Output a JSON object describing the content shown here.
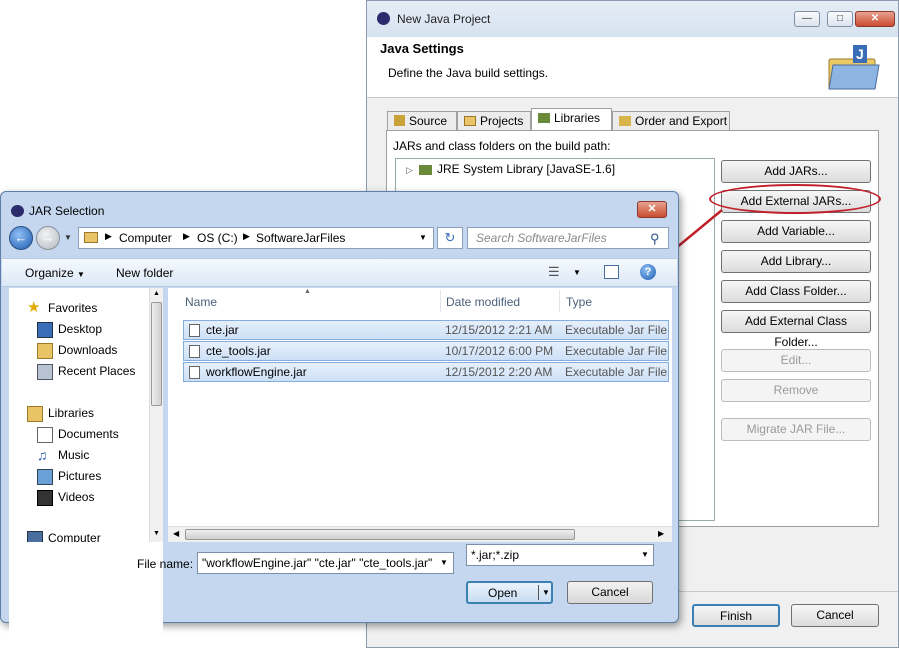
{
  "eclipse": {
    "title": "New Java Project",
    "header_title": "Java Settings",
    "header_desc": "Define the Java build settings.",
    "tabs": [
      "Source",
      "Projects",
      "Libraries",
      "Order and Export"
    ],
    "build_path_label": "JARs and class folders on the build path:",
    "tree_item": "JRE System Library [JavaSE-1.6]",
    "buttons": [
      "Add JARs...",
      "Add External JARs...",
      "Add Variable...",
      "Add Library...",
      "Add Class Folder...",
      "Add External Class Folder...",
      "Edit...",
      "Remove",
      "Migrate JAR File..."
    ],
    "finish": "Finish",
    "cancel": "Cancel"
  },
  "jar": {
    "title": "JAR Selection",
    "breadcrumb": [
      "Computer",
      "OS (C:)",
      "SoftwareJarFiles"
    ],
    "search_placeholder": "Search SoftwareJarFiles",
    "organize": "Organize",
    "new_folder": "New folder",
    "nav": [
      {
        "label": "Favorites",
        "icon": "star-icon"
      },
      {
        "label": "Desktop",
        "icon": "desktop-icon"
      },
      {
        "label": "Downloads",
        "icon": "downloads-icon"
      },
      {
        "label": "Recent Places",
        "icon": "recent-places-icon"
      },
      {
        "label": "Libraries",
        "icon": "libraries-icon"
      },
      {
        "label": "Documents",
        "icon": "documents-icon"
      },
      {
        "label": "Music",
        "icon": "music-icon"
      },
      {
        "label": "Pictures",
        "icon": "pictures-icon"
      },
      {
        "label": "Videos",
        "icon": "videos-icon"
      },
      {
        "label": "Computer",
        "icon": "computer-icon"
      }
    ],
    "columns": [
      "Name",
      "Date modified",
      "Type"
    ],
    "files": [
      {
        "name": "cte.jar",
        "date": "12/15/2012 2:21 AM",
        "type": "Executable Jar File"
      },
      {
        "name": "cte_tools.jar",
        "date": "10/17/2012 6:00 PM",
        "type": "Executable Jar File"
      },
      {
        "name": "workflowEngine.jar",
        "date": "12/15/2012 2:20 AM",
        "type": "Executable Jar File"
      }
    ],
    "file_name_label": "File name:",
    "file_name_value": "\"workflowEngine.jar\" \"cte.jar\" \"cte_tools.jar\"",
    "filter": "*.jar;*.zip",
    "open": "Open",
    "cancel": "Cancel"
  },
  "colors": {
    "highlight": "#c0202a",
    "selection": "#cde0f7",
    "titlebar": "#c4d7ee"
  }
}
